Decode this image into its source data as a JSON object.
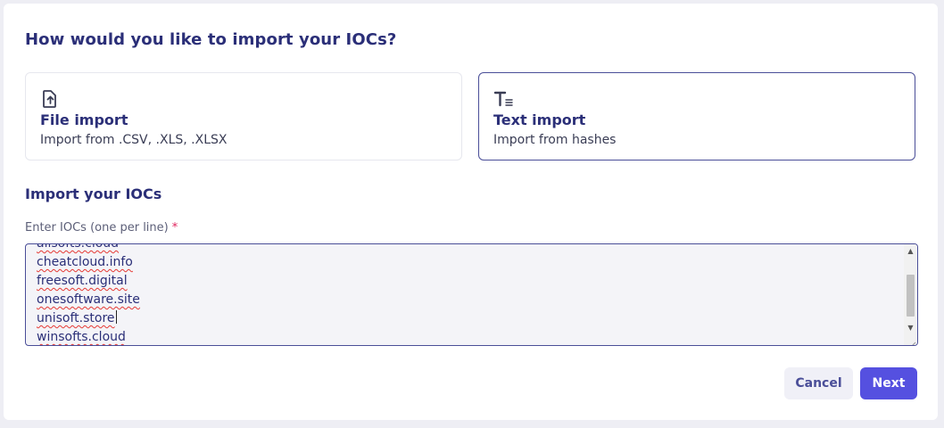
{
  "dialog": {
    "title": "How would you like to import your IOCs?"
  },
  "options": [
    {
      "icon": "file-upload-icon",
      "title": "File import",
      "subtitle": "Import from .CSV, .XLS, .XLSX"
    },
    {
      "icon": "text-format-icon",
      "title": "Text import",
      "subtitle": "Import from hashes"
    }
  ],
  "section": {
    "title": "Import your IOCs",
    "field_label": "Enter IOCs (one per line)",
    "required_mark": "*"
  },
  "iocs": {
    "lines": [
      "allsofts.cloud",
      "cheatcloud.info",
      "freesoft.digital",
      "onesoftware.site",
      "unisoft.store",
      "winsofts.cloud"
    ]
  },
  "actions": {
    "cancel_label": "Cancel",
    "next_label": "Next"
  },
  "colors": {
    "accent": "#5550e0",
    "heading": "#2b2f78",
    "required": "#e0245e",
    "selected_border": "#4a4e98"
  }
}
